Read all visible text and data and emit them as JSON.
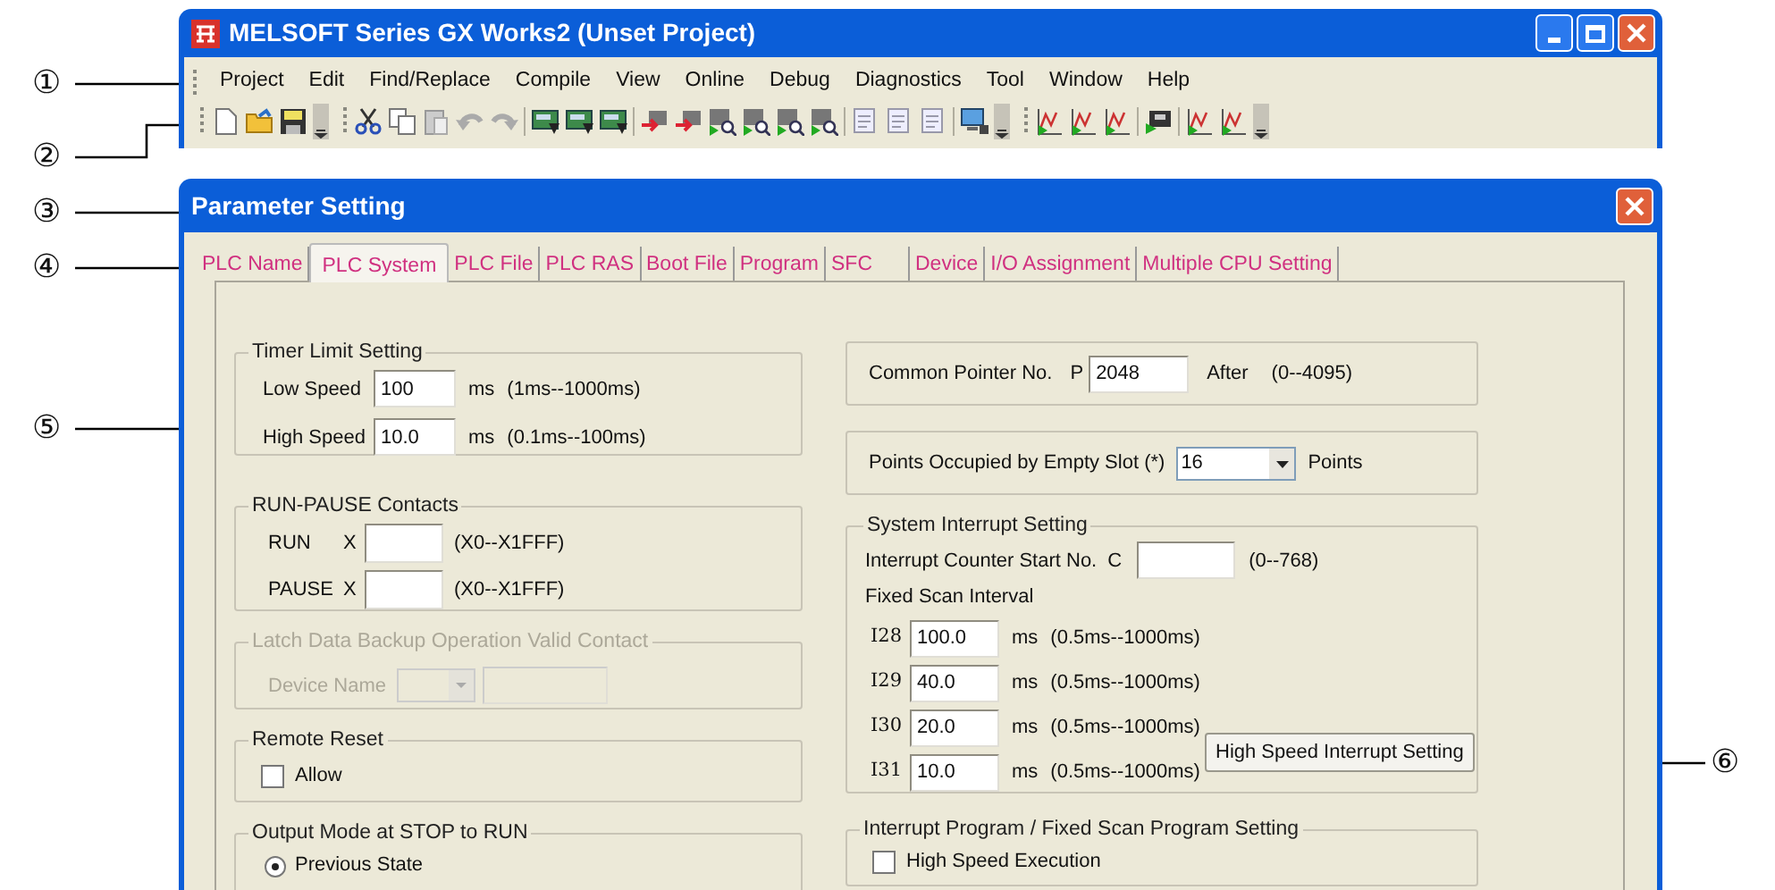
{
  "callouts": [
    {
      "label": "①"
    },
    {
      "label": "②"
    },
    {
      "label": "③"
    },
    {
      "label": "④"
    },
    {
      "label": "⑤"
    },
    {
      "label": "⑥"
    }
  ],
  "main_window": {
    "title": "MELSOFT Series GX Works2 (Unset Project)",
    "menu": [
      {
        "label": "Project"
      },
      {
        "label": "Edit"
      },
      {
        "label": "Find/Replace"
      },
      {
        "label": "Compile"
      },
      {
        "label": "View"
      },
      {
        "label": "Online"
      },
      {
        "label": "Debug"
      },
      {
        "label": "Diagnostics"
      },
      {
        "label": "Tool"
      },
      {
        "label": "Window"
      },
      {
        "label": "Help"
      }
    ]
  },
  "dialog": {
    "title": "Parameter Setting",
    "tabs": [
      {
        "label": "PLC Name",
        "selected": false
      },
      {
        "label": "PLC System",
        "selected": true
      },
      {
        "label": "PLC File",
        "selected": false
      },
      {
        "label": "PLC RAS",
        "selected": false
      },
      {
        "label": "Boot File",
        "selected": false
      },
      {
        "label": "Program",
        "selected": false
      },
      {
        "label": "SFC",
        "selected": false
      },
      {
        "label": "Device",
        "selected": false
      },
      {
        "label": "I/O Assignment",
        "selected": false
      },
      {
        "label": "Multiple CPU Setting",
        "selected": false
      }
    ],
    "left_groups": [
      {
        "kind": "rows",
        "legend": "Timer Limit Setting",
        "disabled": false,
        "rows": [
          {
            "label": "Low Speed",
            "value": "100",
            "unit": "ms",
            "range": "(1ms--1000ms)"
          },
          {
            "label": "High Speed",
            "value": "10.0",
            "unit": "ms",
            "range": "(0.1ms--100ms)"
          }
        ]
      },
      {
        "kind": "contacts",
        "legend": "RUN-PAUSE Contacts",
        "disabled": false,
        "rows": [
          {
            "label": "RUN",
            "prefix": "X",
            "range": "(X0--X1FFF)"
          },
          {
            "label": "PAUSE",
            "prefix": "X",
            "range": "(X0--X1FFF)"
          }
        ]
      },
      {
        "kind": "device",
        "legend": "Latch Data Backup Operation Valid Contact",
        "disabled": true,
        "label": "Device Name"
      },
      {
        "kind": "checkbox",
        "legend": "Remote Reset",
        "disabled": false,
        "label": "Allow",
        "checked": false
      },
      {
        "kind": "radio",
        "legend": "Output Mode at STOP to RUN",
        "disabled": false,
        "options": [
          {
            "label": "Previous State",
            "selected": true
          }
        ]
      }
    ],
    "right_groups": [
      {
        "kind": "pointer",
        "label": "Common Pointer No.",
        "prefix": "P",
        "value": "2048",
        "suffix": "After",
        "range": "(0--4095)"
      },
      {
        "kind": "select",
        "label": "Points Occupied by Empty Slot (*)",
        "value": "16",
        "suffix": "Points"
      },
      {
        "kind": "interrupt",
        "legend": "System Interrupt Setting",
        "counter": {
          "label": "Interrupt Counter Start No.",
          "prefix": "C",
          "range": "(0--768)"
        },
        "subheading": "Fixed Scan Interval",
        "rows": [
          {
            "label": "I28",
            "value": "100.0",
            "unit": "ms",
            "range": "(0.5ms--1000ms)"
          },
          {
            "label": "I29",
            "value": "40.0",
            "unit": "ms",
            "range": "(0.5ms--1000ms)"
          },
          {
            "label": "I30",
            "value": "20.0",
            "unit": "ms",
            "range": "(0.5ms--1000ms)"
          },
          {
            "label": "I31",
            "value": "10.0",
            "unit": "ms",
            "range": "(0.5ms--1000ms)"
          }
        ],
        "button": "High Speed Interrupt Setting"
      },
      {
        "kind": "checkbox",
        "legend": "Interrupt Program / Fixed Scan Program Setting",
        "disabled": false,
        "label": "High Speed Execution",
        "checked": false
      }
    ]
  }
}
